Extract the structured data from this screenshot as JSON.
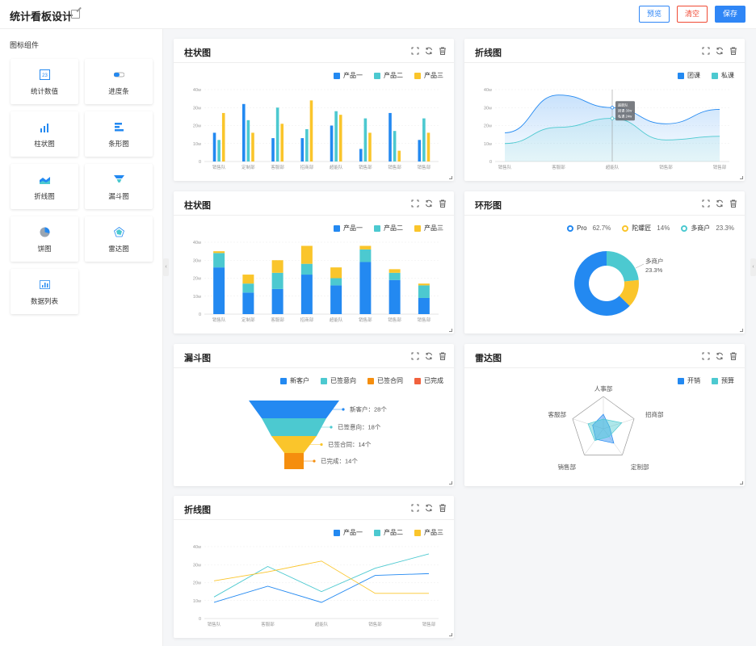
{
  "header": {
    "title": "统计看板设计",
    "preview": "预览",
    "clear": "清空",
    "save": "保存"
  },
  "sidebar": {
    "heading": "图标组件",
    "widgets": [
      {
        "label": "统计数值",
        "icon": "number-23-icon",
        "glyph": "23"
      },
      {
        "label": "进度条",
        "icon": "progress-icon"
      },
      {
        "label": "柱状图",
        "icon": "bar-chart-icon"
      },
      {
        "label": "条形图",
        "icon": "hbar-chart-icon"
      },
      {
        "label": "折线图",
        "icon": "area-chart-icon"
      },
      {
        "label": "漏斗图",
        "icon": "funnel-icon"
      },
      {
        "label": "饼图",
        "icon": "pie-icon"
      },
      {
        "label": "雷达图",
        "icon": "radar-icon"
      },
      {
        "label": "数据列表",
        "icon": "data-list-icon"
      }
    ]
  },
  "colors": {
    "blue": "#2389f1",
    "cyan": "#4cc9d0",
    "yellow": "#fac52b",
    "orange": "#f58e0e",
    "red": "#f1613d"
  },
  "cards": {
    "bar1": {
      "title": "柱状图"
    },
    "line1": {
      "title": "折线图"
    },
    "bar2": {
      "title": "柱状图"
    },
    "ring": {
      "title": "环形图"
    },
    "funnel": {
      "title": "漏斗图"
    },
    "radar": {
      "title": "雷达图"
    },
    "line2": {
      "title": "折线图"
    }
  },
  "chart_data": [
    {
      "id": "bar1",
      "type": "bar",
      "ylim": [
        0,
        40
      ],
      "yticks": [
        "0",
        "10w",
        "20w",
        "30w",
        "40w"
      ],
      "categories": [
        "销售队",
        "定制部",
        "客服部",
        "招商部",
        "超能队",
        "销售部",
        "销售部",
        "销售部"
      ],
      "series": [
        {
          "name": "产品一",
          "values": [
            16,
            32,
            13,
            13,
            20,
            7,
            27,
            12
          ]
        },
        {
          "name": "产品二",
          "values": [
            12,
            23,
            30,
            18,
            28,
            24,
            17,
            24
          ]
        },
        {
          "name": "产品三",
          "values": [
            27,
            16,
            21,
            34,
            26,
            16,
            6,
            16
          ]
        }
      ]
    },
    {
      "id": "line1",
      "type": "area",
      "ylim": [
        0,
        40
      ],
      "yticks": [
        "0",
        "10w",
        "20w",
        "30w",
        "40w"
      ],
      "categories": [
        "销售队",
        "客服部",
        "超能队",
        "销售部",
        "销售部"
      ],
      "series": [
        {
          "name": "团课",
          "values": [
            16,
            37,
            30,
            21,
            29
          ]
        },
        {
          "name": "私课",
          "values": [
            10,
            19,
            24,
            12,
            14
          ]
        }
      ],
      "tooltip": {
        "lines": [
          "超能队",
          "团课 30w",
          "私课 24w"
        ]
      }
    },
    {
      "id": "bar2",
      "type": "stacked-bar",
      "ylim": [
        0,
        40
      ],
      "yticks": [
        "0",
        "10w",
        "20w",
        "30w",
        "40w"
      ],
      "categories": [
        "销售队",
        "定制部",
        "客服部",
        "招商部",
        "超能队",
        "销售部",
        "销售部",
        "销售部"
      ],
      "series": [
        {
          "name": "产品一",
          "values": [
            26,
            12,
            14,
            22,
            16,
            29,
            19,
            9
          ]
        },
        {
          "name": "产品二",
          "values": [
            8,
            5,
            9,
            6,
            4,
            7,
            4,
            7
          ]
        },
        {
          "name": "产品三",
          "values": [
            1,
            5,
            7,
            10,
            6,
            2,
            2,
            1
          ]
        }
      ]
    },
    {
      "id": "ring",
      "type": "pie",
      "slices": [
        {
          "name": "Pro",
          "pct": "62.7%",
          "value": 62.7
        },
        {
          "name": "陀螺匠",
          "pct": "14%",
          "value": 14
        },
        {
          "name": "多商户",
          "pct": "23.3%",
          "value": 23.3
        }
      ],
      "callout": {
        "name": "多商户",
        "pct": "23.3%"
      }
    },
    {
      "id": "funnel",
      "type": "funnel",
      "stages": [
        {
          "name": "新客户",
          "label": "新客户：28个",
          "value": 28
        },
        {
          "name": "已签意向",
          "label": "已签意向：18个",
          "value": 18
        },
        {
          "name": "已签合同",
          "label": "已签合同：14个",
          "value": 14
        },
        {
          "name": "已完成",
          "label": "已完成：14个",
          "value": 14
        }
      ]
    },
    {
      "id": "radar",
      "type": "radar",
      "axes": [
        "人事部",
        "招商部",
        "定制部",
        "销售部",
        "客服部"
      ],
      "series": [
        {
          "name": "开销",
          "values": [
            0.45,
            0.2,
            0.55,
            0.4,
            0.35
          ]
        },
        {
          "name": "预算",
          "values": [
            0.3,
            0.6,
            0.3,
            0.45,
            0.5
          ]
        }
      ]
    },
    {
      "id": "line2",
      "type": "line",
      "ylim": [
        0,
        40
      ],
      "yticks": [
        "0",
        "10w",
        "20w",
        "30w",
        "40w"
      ],
      "categories": [
        "销售队",
        "客服部",
        "超能队",
        "销售部",
        "销售部"
      ],
      "series": [
        {
          "name": "产品一",
          "values": [
            9,
            18,
            9,
            24,
            25
          ]
        },
        {
          "name": "产品二",
          "values": [
            12,
            29,
            15,
            28,
            36
          ]
        },
        {
          "name": "产品三",
          "values": [
            21,
            26,
            32,
            14,
            14
          ]
        }
      ]
    }
  ]
}
